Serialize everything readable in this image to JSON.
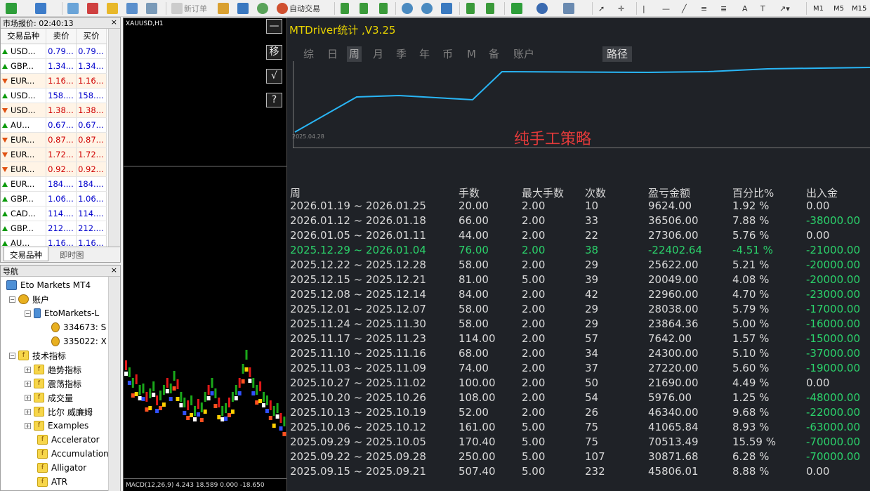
{
  "toolbar": {
    "new_order": "新订单",
    "auto_trading": "自动交易",
    "timeframes": [
      "M1",
      "M5",
      "M15"
    ]
  },
  "market_watch": {
    "title": "市场报价: 02:40:13",
    "columns": [
      "交易品种",
      "卖价",
      "买价"
    ],
    "rows": [
      {
        "symbol": "USD...",
        "bid": "0.79...",
        "ask": "0.79...",
        "dir": "up"
      },
      {
        "symbol": "GBP...",
        "bid": "1.34...",
        "ask": "1.34...",
        "dir": "up"
      },
      {
        "symbol": "EUR...",
        "bid": "1.16...",
        "ask": "1.16...",
        "dir": "down"
      },
      {
        "symbol": "USD...",
        "bid": "158....",
        "ask": "158....",
        "dir": "up"
      },
      {
        "symbol": "USD...",
        "bid": "1.38...",
        "ask": "1.38...",
        "dir": "down"
      },
      {
        "symbol": "AU...",
        "bid": "0.67...",
        "ask": "0.67...",
        "dir": "up"
      },
      {
        "symbol": "EUR...",
        "bid": "0.87...",
        "ask": "0.87...",
        "dir": "down"
      },
      {
        "symbol": "EUR...",
        "bid": "1.72...",
        "ask": "1.72...",
        "dir": "down"
      },
      {
        "symbol": "EUR...",
        "bid": "0.92...",
        "ask": "0.92...",
        "dir": "down"
      },
      {
        "symbol": "EUR...",
        "bid": "184....",
        "ask": "184....",
        "dir": "up"
      },
      {
        "symbol": "GBP...",
        "bid": "1.06...",
        "ask": "1.06...",
        "dir": "up"
      },
      {
        "symbol": "CAD...",
        "bid": "114....",
        "ask": "114....",
        "dir": "up"
      },
      {
        "symbol": "GBP...",
        "bid": "212....",
        "ask": "212....",
        "dir": "up"
      },
      {
        "symbol": "AU...",
        "bid": "1.16...",
        "ask": "1.16...",
        "dir": "up"
      }
    ],
    "tabs": [
      "交易品种",
      "即时图"
    ]
  },
  "navigator": {
    "title": "导航",
    "items": [
      {
        "label": "Eto Markets MT4"
      },
      {
        "label": "账户"
      },
      {
        "label": "EtoMarkets-L"
      },
      {
        "label": "334673: S"
      },
      {
        "label": "335022: X"
      },
      {
        "label": "技术指标"
      },
      {
        "label": "趋势指标"
      },
      {
        "label": "震荡指标"
      },
      {
        "label": "成交量"
      },
      {
        "label": "比尔 威廉姆"
      },
      {
        "label": "Examples"
      },
      {
        "label": "Accelerator"
      },
      {
        "label": "Accumulation"
      },
      {
        "label": "Alligator"
      },
      {
        "label": "ATR"
      }
    ]
  },
  "chart": {
    "symbol": "XAUUSD,H1",
    "macd": "MACD(12,26,9) 4.243 18.589 0.000 -18.650"
  },
  "side_buttons": [
    "—",
    "移",
    "√",
    "?"
  ],
  "panel": {
    "title": "MTDriver统计 ,V3.25",
    "tabs": [
      "综",
      "日",
      "周",
      "月",
      "季",
      "年",
      "币",
      "M",
      "备",
      "账户"
    ],
    "selected_tab": "周",
    "path_tab": "路径",
    "strategy": "纯手工策略",
    "start_date": "2025.04.28",
    "headers": [
      "周",
      "手数",
      "最大手数",
      "次数",
      "盈亏金额",
      "百分比%",
      "出入金"
    ],
    "rows": [
      {
        "week": "2026.01.19 ~ 2026.01.25",
        "lots": "20.00",
        "max_lots": "2.00",
        "count": "10",
        "pnl": "9624.00",
        "pct": "1.92 %",
        "flow": "0.00"
      },
      {
        "week": "2026.01.12 ~ 2026.01.18",
        "lots": "66.00",
        "max_lots": "2.00",
        "count": "33",
        "pnl": "36506.00",
        "pct": "7.88 %",
        "flow": "-38000.00"
      },
      {
        "week": "2026.01.05 ~ 2026.01.11",
        "lots": "44.00",
        "max_lots": "2.00",
        "count": "22",
        "pnl": "27306.00",
        "pct": "5.76 %",
        "flow": "0.00"
      },
      {
        "week": "2025.12.29 ~ 2026.01.04",
        "lots": "76.00",
        "max_lots": "2.00",
        "count": "38",
        "pnl": "-22402.64",
        "pct": "-4.51 %",
        "flow": "-21000.00"
      },
      {
        "week": "2025.12.22 ~ 2025.12.28",
        "lots": "58.00",
        "max_lots": "2.00",
        "count": "29",
        "pnl": "25622.00",
        "pct": "5.21 %",
        "flow": "-20000.00"
      },
      {
        "week": "2025.12.15 ~ 2025.12.21",
        "lots": "81.00",
        "max_lots": "5.00",
        "count": "39",
        "pnl": "20049.00",
        "pct": "4.08 %",
        "flow": "-20000.00"
      },
      {
        "week": "2025.12.08 ~ 2025.12.14",
        "lots": "84.00",
        "max_lots": "2.00",
        "count": "42",
        "pnl": "22960.00",
        "pct": "4.70 %",
        "flow": "-23000.00"
      },
      {
        "week": "2025.12.01 ~ 2025.12.07",
        "lots": "58.00",
        "max_lots": "2.00",
        "count": "29",
        "pnl": "28038.00",
        "pct": "5.79 %",
        "flow": "-17000.00"
      },
      {
        "week": "2025.11.24 ~ 2025.11.30",
        "lots": "58.00",
        "max_lots": "2.00",
        "count": "29",
        "pnl": "23864.36",
        "pct": "5.00 %",
        "flow": "-16000.00"
      },
      {
        "week": "2025.11.17 ~ 2025.11.23",
        "lots": "114.00",
        "max_lots": "2.00",
        "count": "57",
        "pnl": "7642.00",
        "pct": "1.57 %",
        "flow": "-15000.00"
      },
      {
        "week": "2025.11.10 ~ 2025.11.16",
        "lots": "68.00",
        "max_lots": "2.00",
        "count": "34",
        "pnl": "24300.00",
        "pct": "5.10 %",
        "flow": "-37000.00"
      },
      {
        "week": "2025.11.03 ~ 2025.11.09",
        "lots": "74.00",
        "max_lots": "2.00",
        "count": "37",
        "pnl": "27220.00",
        "pct": "5.60 %",
        "flow": "-19000.00"
      },
      {
        "week": "2025.10.27 ~ 2025.11.02",
        "lots": "100.00",
        "max_lots": "2.00",
        "count": "50",
        "pnl": "21690.00",
        "pct": "4.49 %",
        "flow": "0.00"
      },
      {
        "week": "2025.10.20 ~ 2025.10.26",
        "lots": "108.00",
        "max_lots": "2.00",
        "count": "54",
        "pnl": "5976.00",
        "pct": "1.25 %",
        "flow": "-48000.00"
      },
      {
        "week": "2025.10.13 ~ 2025.10.19",
        "lots": "52.00",
        "max_lots": "2.00",
        "count": "26",
        "pnl": "46340.00",
        "pct": "9.68 %",
        "flow": "-22000.00"
      },
      {
        "week": "2025.10.06 ~ 2025.10.12",
        "lots": "161.00",
        "max_lots": "5.00",
        "count": "75",
        "pnl": "41065.84",
        "pct": "8.93 %",
        "flow": "-63000.00"
      },
      {
        "week": "2025.09.29 ~ 2025.10.05",
        "lots": "170.40",
        "max_lots": "5.00",
        "count": "75",
        "pnl": "70513.49",
        "pct": "15.59 %",
        "flow": "-70000.00"
      },
      {
        "week": "2025.09.22 ~ 2025.09.28",
        "lots": "250.00",
        "max_lots": "5.00",
        "count": "107",
        "pnl": "30871.68",
        "pct": "6.28 %",
        "flow": "-70000.00"
      },
      {
        "week": "2025.09.15 ~ 2025.09.21",
        "lots": "507.40",
        "max_lots": "5.00",
        "count": "232",
        "pnl": "45806.01",
        "pct": "8.88 %",
        "flow": "0.00"
      }
    ],
    "colors": {
      "title": "#e8d300",
      "positive": "#d8d8d8",
      "negative": "#2bd26b",
      "line": "#29b6f6",
      "strategy": "#e23a3a"
    }
  }
}
